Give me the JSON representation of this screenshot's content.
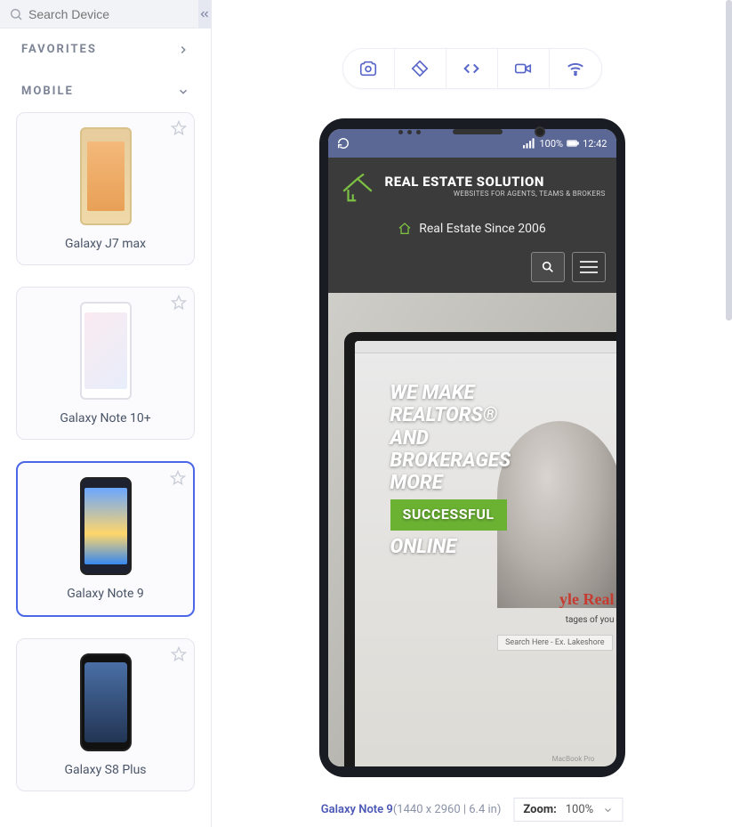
{
  "search": {
    "placeholder": "Search Device"
  },
  "sections": {
    "favorites_label": "FAVORITES",
    "mobile_label": "MOBILE"
  },
  "devices": [
    {
      "name": "Galaxy J7 max",
      "selected": false,
      "style": "dev-gold"
    },
    {
      "name": "Galaxy Note 10+",
      "selected": false,
      "style": "dev-white"
    },
    {
      "name": "Galaxy Note 9",
      "selected": true,
      "style": "dev-dark"
    },
    {
      "name": "Galaxy S8 Plus",
      "selected": false,
      "style": "dev-s8"
    }
  ],
  "phone": {
    "status": {
      "signal_pct": "100%",
      "time": "12:42"
    },
    "site": {
      "brand_title": "REAL ESTATE SOLUTION",
      "brand_sub": "WEBSITES FOR AGENTS, TEAMS & BROKERS",
      "tagline": "Real Estate Since 2006",
      "hero_line1": "WE MAKE",
      "hero_line2": "REALTORS®",
      "hero_line3": "AND",
      "hero_line4": "BROKERAGES",
      "hero_line5": "MORE",
      "hero_badge": "SUCCESSFUL",
      "hero_line6": "ONLINE",
      "side_text": "yle Real",
      "side_text2": "tages of you",
      "search_hint": "Search Here - Ex. Lakeshore",
      "laptop_label": "MacBook Pro"
    }
  },
  "footer": {
    "device_name": "Galaxy Note 9",
    "dims": "(1440 x 2960 | 6.4 in)",
    "zoom_label": "Zoom:",
    "zoom_value": "100%"
  },
  "dock_colors": [
    "#4aa3ff",
    "#5fb4e0",
    "#9c6fe0",
    "#e07752",
    "#5fc8c2",
    "#f3b64e",
    "#5079e0",
    "#72b564",
    "#e05f98",
    "#f0d24f",
    "#6fb1f0",
    "#e0864f",
    "#f0c04f",
    "#6fe0b1",
    "#4f8fe0",
    "#e04f7a",
    "#f0e04f",
    "#e07d4f",
    "#5fcfe0",
    "#7d5fe0"
  ]
}
